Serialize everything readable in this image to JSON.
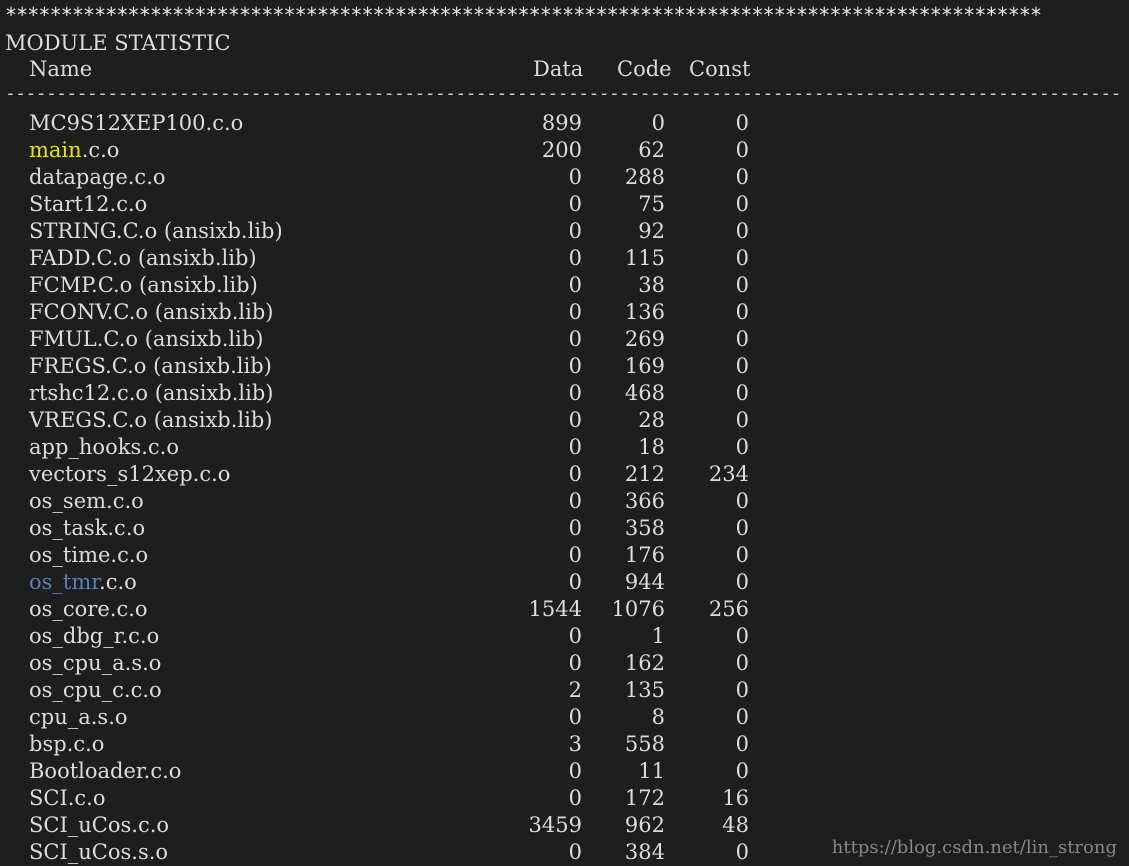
{
  "stars": "*********************************************************************************************",
  "title": "MODULE STATISTIC",
  "header": {
    "name": "Name",
    "data": "Data",
    "code": "Code",
    "const": "Const"
  },
  "separator": "----------------------------------------------------------------------------------------------------------------",
  "rows": [
    {
      "name": "MC9S12XEP100.c.o",
      "data": "899",
      "code": "0",
      "const": "0"
    },
    {
      "name_hl": "main",
      "name_rest": ".c.o",
      "hl": "yellow",
      "data": "200",
      "code": "62",
      "const": "0"
    },
    {
      "name": "datapage.c.o",
      "data": "0",
      "code": "288",
      "const": "0"
    },
    {
      "name": "Start12.c.o",
      "data": "0",
      "code": "75",
      "const": "0"
    },
    {
      "name": "STRING.C.o (ansixb.lib)",
      "data": "0",
      "code": "92",
      "const": "0"
    },
    {
      "name": "FADD.C.o (ansixb.lib)",
      "data": "0",
      "code": "115",
      "const": "0"
    },
    {
      "name": "FCMP.C.o (ansixb.lib)",
      "data": "0",
      "code": "38",
      "const": "0"
    },
    {
      "name": "FCONV.C.o (ansixb.lib)",
      "data": "0",
      "code": "136",
      "const": "0"
    },
    {
      "name": "FMUL.C.o (ansixb.lib)",
      "data": "0",
      "code": "269",
      "const": "0"
    },
    {
      "name": "FREGS.C.o (ansixb.lib)",
      "data": "0",
      "code": "169",
      "const": "0"
    },
    {
      "name": "rtshc12.c.o (ansixb.lib)",
      "data": "0",
      "code": "468",
      "const": "0"
    },
    {
      "name": "VREGS.C.o (ansixb.lib)",
      "data": "0",
      "code": "28",
      "const": "0"
    },
    {
      "name": "app_hooks.c.o",
      "data": "0",
      "code": "18",
      "const": "0"
    },
    {
      "name": "vectors_s12xep.c.o",
      "data": "0",
      "code": "212",
      "const": "234"
    },
    {
      "name": "os_sem.c.o",
      "data": "0",
      "code": "366",
      "const": "0"
    },
    {
      "name": "os_task.c.o",
      "data": "0",
      "code": "358",
      "const": "0"
    },
    {
      "name": "os_time.c.o",
      "data": "0",
      "code": "176",
      "const": "0"
    },
    {
      "name_hl": "os_tmr",
      "name_rest": ".c.o",
      "hl": "blue",
      "data": "0",
      "code": "944",
      "const": "0"
    },
    {
      "name": "os_core.c.o",
      "data": "1544",
      "code": "1076",
      "const": "256"
    },
    {
      "name": "os_dbg_r.c.o",
      "data": "0",
      "code": "1",
      "const": "0"
    },
    {
      "name": "os_cpu_a.s.o",
      "data": "0",
      "code": "162",
      "const": "0"
    },
    {
      "name": "os_cpu_c.c.o",
      "data": "2",
      "code": "135",
      "const": "0"
    },
    {
      "name": "cpu_a.s.o",
      "data": "0",
      "code": "8",
      "const": "0"
    },
    {
      "name": "bsp.c.o",
      "data": "3",
      "code": "558",
      "const": "0"
    },
    {
      "name": "Bootloader.c.o",
      "data": "0",
      "code": "11",
      "const": "0"
    },
    {
      "name": "SCI.c.o",
      "data": "0",
      "code": "172",
      "const": "16"
    },
    {
      "name": "SCI_uCos.c.o",
      "data": "3459",
      "code": "962",
      "const": "48"
    },
    {
      "name": "SCI_uCos.s.o",
      "data": "0",
      "code": "384",
      "const": "0"
    }
  ],
  "watermark": "https://blog.csdn.net/lin_strong",
  "colors": {
    "background": "#1e1e1e",
    "text": "#dcdcdc",
    "highlight_yellow": "#e5e510",
    "highlight_blue": "#5b7fb8"
  }
}
